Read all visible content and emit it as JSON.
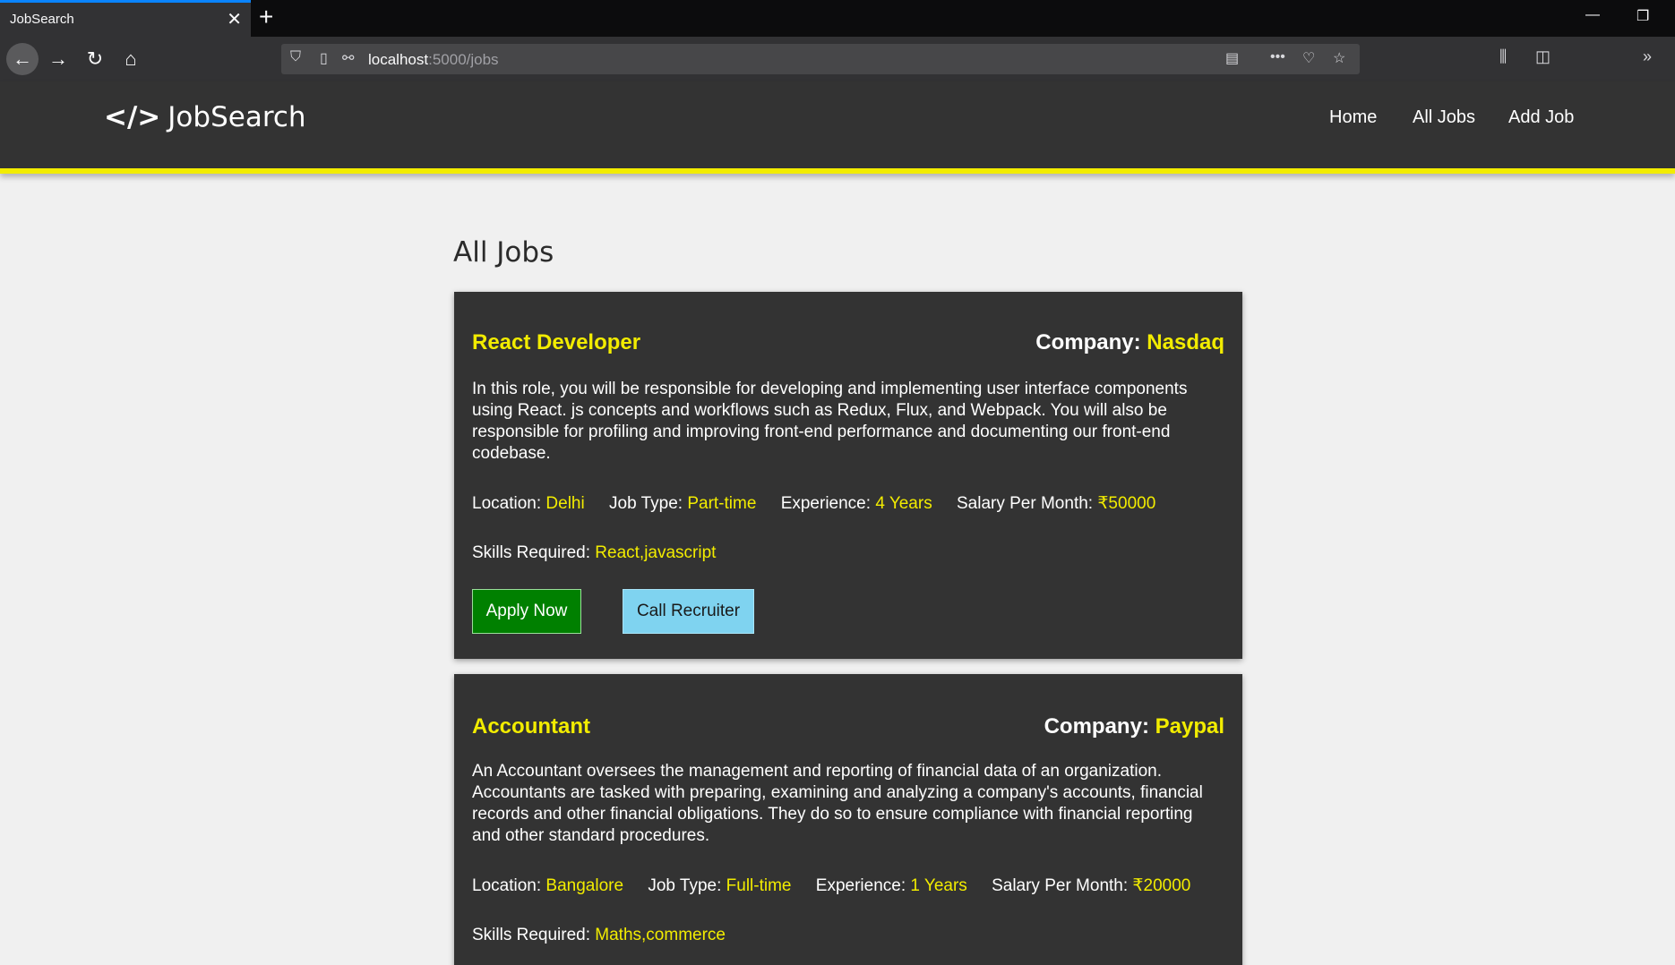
{
  "browser": {
    "tab_title": "JobSearch",
    "tab_close": "✕",
    "new_tab": "+",
    "url_host": "localhost",
    "url_path": ":5000/jobs"
  },
  "header": {
    "logo_icon": "</>",
    "logo_text": "JobSearch",
    "nav": [
      "Home",
      "All Jobs",
      "Add Job"
    ]
  },
  "page": {
    "title": "All Jobs"
  },
  "jobs": [
    {
      "title": "React Developer",
      "company_label": "Company: ",
      "company": "Nasdaq",
      "description": "In this role, you will be responsible for developing and implementing user interface components using React. js concepts and workflows such as Redux, Flux, and Webpack. You will also be responsible for profiling and improving front-end performance and documenting our front-end codebase.",
      "location_label": "Location: ",
      "location": "Delhi",
      "job_type_label": "Job Type: ",
      "job_type": "Part-time",
      "experience_label": "Experience: ",
      "experience": "4 Years",
      "salary_label": "Salary Per Month: ",
      "salary": "₹50000",
      "skills_label": "Skills Required: ",
      "skills": "React,javascript",
      "apply_label": "Apply Now",
      "call_label": "Call Recruiter"
    },
    {
      "title": "Accountant",
      "company_label": "Company: ",
      "company": "Paypal",
      "description": "An Accountant oversees the management and reporting of financial data of an organization. Accountants are tasked with preparing, examining and analyzing a company's accounts, financial records and other financial obligations. They do so to ensure compliance with financial reporting and other standard procedures.",
      "location_label": "Location: ",
      "location": "Bangalore",
      "job_type_label": "Job Type: ",
      "job_type": "Full-time",
      "experience_label": "Experience: ",
      "experience": "1 Years",
      "salary_label": "Salary Per Month: ",
      "salary": "₹20000",
      "skills_label": "Skills Required: ",
      "skills": "Maths,commerce"
    }
  ],
  "colors": {
    "accent": "#f2ec00",
    "header_bg": "#333333",
    "apply_bg": "#008000",
    "call_bg": "#7fd3f0"
  }
}
